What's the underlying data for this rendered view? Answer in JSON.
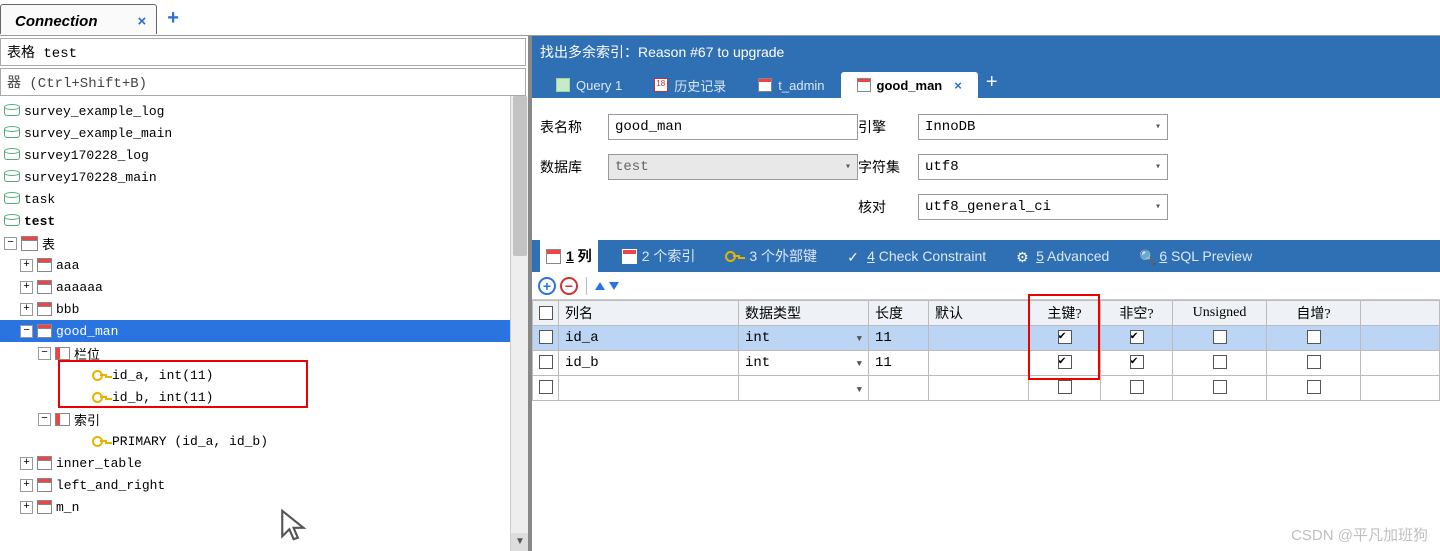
{
  "conn_tab_label": "Connection",
  "filter_tables_label": "表格 test",
  "filter_hint": "器 (Ctrl+Shift+B)",
  "tree_tables_header": "表",
  "db_tables": [
    "survey_example_log",
    "survey_example_main",
    "survey170228_log",
    "survey170228_main",
    "task",
    "test"
  ],
  "tables": [
    "aaa",
    "aaaaaa",
    "bbb",
    "good_man"
  ],
  "good_man_columns_label": "栏位",
  "good_man_columns": [
    "id_a, int(11)",
    "id_b, int(11)"
  ],
  "good_man_index_label": "索引",
  "good_man_primary": "PRIMARY (id_a, id_b)",
  "tables_after": [
    "inner_table",
    "left_and_right",
    "m_n"
  ],
  "upgrade_banner": "找出多余索引：Reason #67 to upgrade",
  "editor_tabs": {
    "query1": "Query 1",
    "history": "历史记录",
    "tadmin": "t_admin",
    "goodman": "good_man"
  },
  "form": {
    "table_name_label": "表名称",
    "table_name_value": "good_man",
    "database_label": "数据库",
    "database_value": "test",
    "engine_label": "引擎",
    "engine_value": "InnoDB",
    "charset_label": "字符集",
    "charset_value": "utf8",
    "collation_label": "核对",
    "collation_value": "utf8_general_ci"
  },
  "section_tabs": {
    "cols": "1 列",
    "idx": "2 个索引",
    "fk": "3 个外部键",
    "chk": "4 Check Constraint",
    "adv": "5 Advanced",
    "sql": "6 SQL Preview"
  },
  "grid_headers": {
    "name": "列名",
    "type": "数据类型",
    "len": "长度",
    "def": "默认",
    "pk": "主键?",
    "nn": "非空?",
    "uns": "Unsigned",
    "ai": "自增?"
  },
  "grid_rows": [
    {
      "name": "id_a",
      "type": "int",
      "len": "11",
      "def": "",
      "pk": true,
      "nn": true,
      "uns": false,
      "ai": false
    },
    {
      "name": "id_b",
      "type": "int",
      "len": "11",
      "def": "",
      "pk": true,
      "nn": true,
      "uns": false,
      "ai": false
    }
  ],
  "watermark": "CSDN @平凡加班狗"
}
